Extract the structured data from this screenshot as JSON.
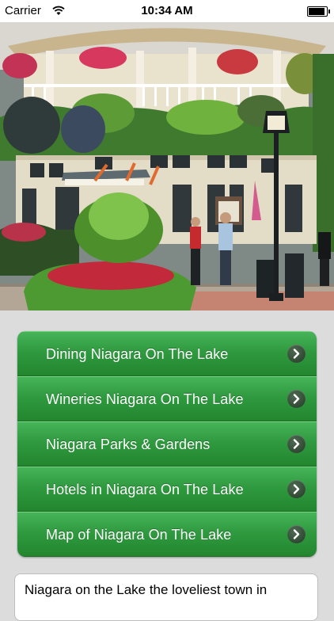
{
  "status_bar": {
    "carrier": "Carrier",
    "time": "10:34 AM",
    "wifi_icon": "wifi-icon",
    "battery_icon": "battery-icon"
  },
  "hero": {
    "image_name": "hero-photo"
  },
  "menu": {
    "items": [
      {
        "label": "Dining Niagara On The Lake",
        "icon": "chevron-right-icon"
      },
      {
        "label": "Wineries Niagara On The Lake",
        "icon": "chevron-right-icon"
      },
      {
        "label": "Niagara Parks & Gardens",
        "icon": "chevron-right-icon"
      },
      {
        "label": "Hotels in Niagara On The Lake",
        "icon": "chevron-right-icon"
      },
      {
        "label": "Map of Niagara On The Lake",
        "icon": "chevron-right-icon"
      }
    ]
  },
  "description": {
    "text": "Niagara on the Lake the loveliest town in"
  },
  "colors": {
    "menu_green": "#2f9a3f",
    "background": "#dcdcdc"
  }
}
